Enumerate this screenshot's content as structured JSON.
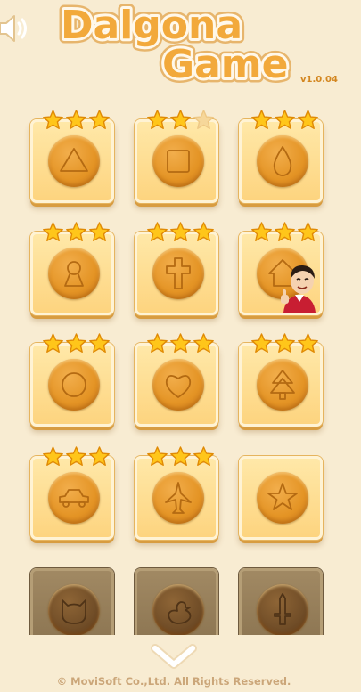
{
  "header": {
    "title_line1": "Dalgona",
    "title_line2": "Game",
    "version": "v1.0.04",
    "sound_icon": "speaker-icon"
  },
  "levels": [
    {
      "shape": "triangle",
      "stars": 3,
      "locked": false
    },
    {
      "shape": "square",
      "stars": 2,
      "locked": false
    },
    {
      "shape": "drop",
      "stars": 3,
      "locked": false
    },
    {
      "shape": "keyhole",
      "stars": 3,
      "locked": false
    },
    {
      "shape": "cross",
      "stars": 3,
      "locked": false
    },
    {
      "shape": "house",
      "stars": 3,
      "locked": false
    },
    {
      "shape": "circle",
      "stars": 3,
      "locked": false
    },
    {
      "shape": "heart",
      "stars": 3,
      "locked": false
    },
    {
      "shape": "tree",
      "stars": 3,
      "locked": false
    },
    {
      "shape": "car",
      "stars": 3,
      "locked": false
    },
    {
      "shape": "airplane",
      "stars": 3,
      "locked": false
    },
    {
      "shape": "star",
      "stars": 0,
      "locked": false
    },
    {
      "shape": "cat",
      "stars": 0,
      "locked": true
    },
    {
      "shape": "duck",
      "stars": 0,
      "locked": true
    },
    {
      "shape": "sword",
      "stars": 0,
      "locked": true
    }
  ],
  "footer": {
    "scroll_icon": "chevron-down-icon",
    "copyright": "© MoviSoft Co.,Ltd. All Rights Reserved."
  },
  "colors": {
    "background": "#f8ecd2",
    "title_fill": "#f2a93b",
    "coin": "#e49425",
    "star": "#ffc61a",
    "locked_tile": "#8a7350"
  }
}
